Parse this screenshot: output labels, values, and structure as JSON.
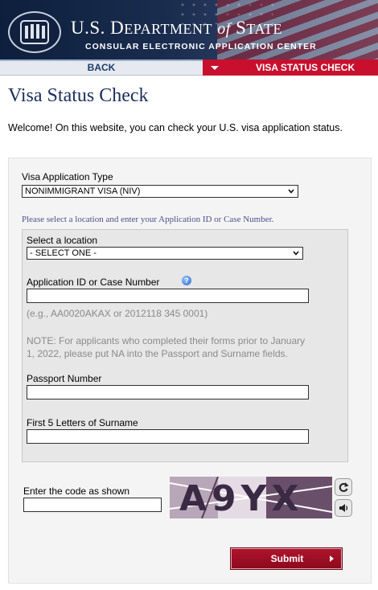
{
  "header": {
    "title_part1": "U.S. D",
    "title_part2": "EPARTMENT",
    "title_of": "of",
    "title_part3": " S",
    "title_part4": "TATE",
    "subtitle": "CONSULAR ELECTRONIC APPLICATION CENTER",
    "seal_icon": "state-department-seal-icon"
  },
  "nav": {
    "back_label": "BACK",
    "current_label": "VISA STATUS CHECK"
  },
  "page": {
    "title": "Visa Status Check",
    "welcome": "Welcome! On this website, you can check your U.S. visa application status."
  },
  "form": {
    "visa_type_label": "Visa Application Type",
    "visa_type_value": "NONIMMIGRANT VISA (NIV)",
    "instruction": "Please select a location and enter your Application ID or Case Number.",
    "location_label": "Select a location",
    "location_value": "- SELECT ONE -",
    "app_id_label": "Application ID or Case Number",
    "app_id_value": "",
    "app_id_example": "(e.g., AA0020AKAX or 2012118 345 0001)",
    "note_line1": "NOTE: For applicants who completed their forms prior to January",
    "note_line2": "1, 2022, please put NA into the Passport and Surname fields.",
    "passport_label": "Passport Number",
    "passport_value": "",
    "surname_label": "First 5 Letters of Surname",
    "surname_value": "",
    "captcha_label": "Enter the code as shown",
    "captcha_value": "",
    "captcha_code": "A9YX",
    "submit_label": "Submit"
  },
  "colors": {
    "accent_red": "#c8102e",
    "title_navy": "#1b2f5e",
    "hint_purple": "#4b4f8a"
  }
}
